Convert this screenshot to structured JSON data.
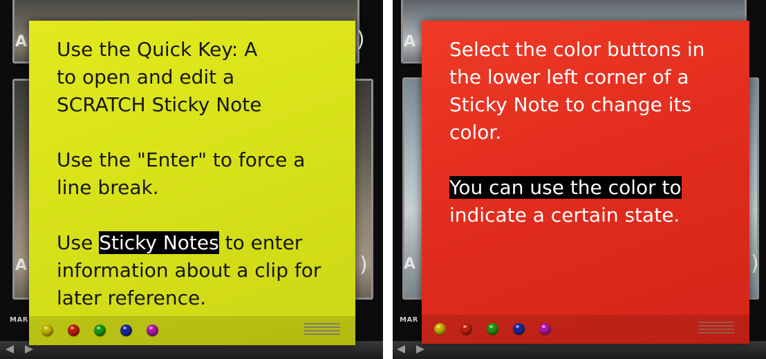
{
  "left_panel": {
    "thumb_letters": [
      "A",
      "A"
    ],
    "mark_label": "MAR",
    "note": {
      "color": "#dbe31a",
      "paragraphs": [
        [
          "Use the Quick Key: A",
          "to open and edit a",
          "SCRATCH Sticky Note"
        ],
        [
          "Use the \"Enter\" to force a",
          "line break."
        ]
      ],
      "p3": {
        "before": "Use ",
        "highlight": "Sticky Notes",
        "after": " to enter",
        "line2": "information about a clip for",
        "line3": "later reference."
      },
      "color_buttons": [
        "#c8b400",
        "#c0200c",
        "#1e9a14",
        "#1c2a9a",
        "#b01aa8"
      ]
    }
  },
  "right_panel": {
    "thumb_letters": [
      "A",
      "A"
    ],
    "mark_label": "MAR",
    "note": {
      "color": "#e2301f",
      "paragraph1": [
        "Select the color buttons in",
        "the lower left corner of a",
        "Sticky Note to change its",
        "color."
      ],
      "highlight_line": "You can use the color to",
      "last_line": "indicate a certain state.",
      "color_buttons": [
        "#c8b400",
        "#c0200c",
        "#1e9a14",
        "#1c2a9a",
        "#b01aa8"
      ]
    }
  }
}
